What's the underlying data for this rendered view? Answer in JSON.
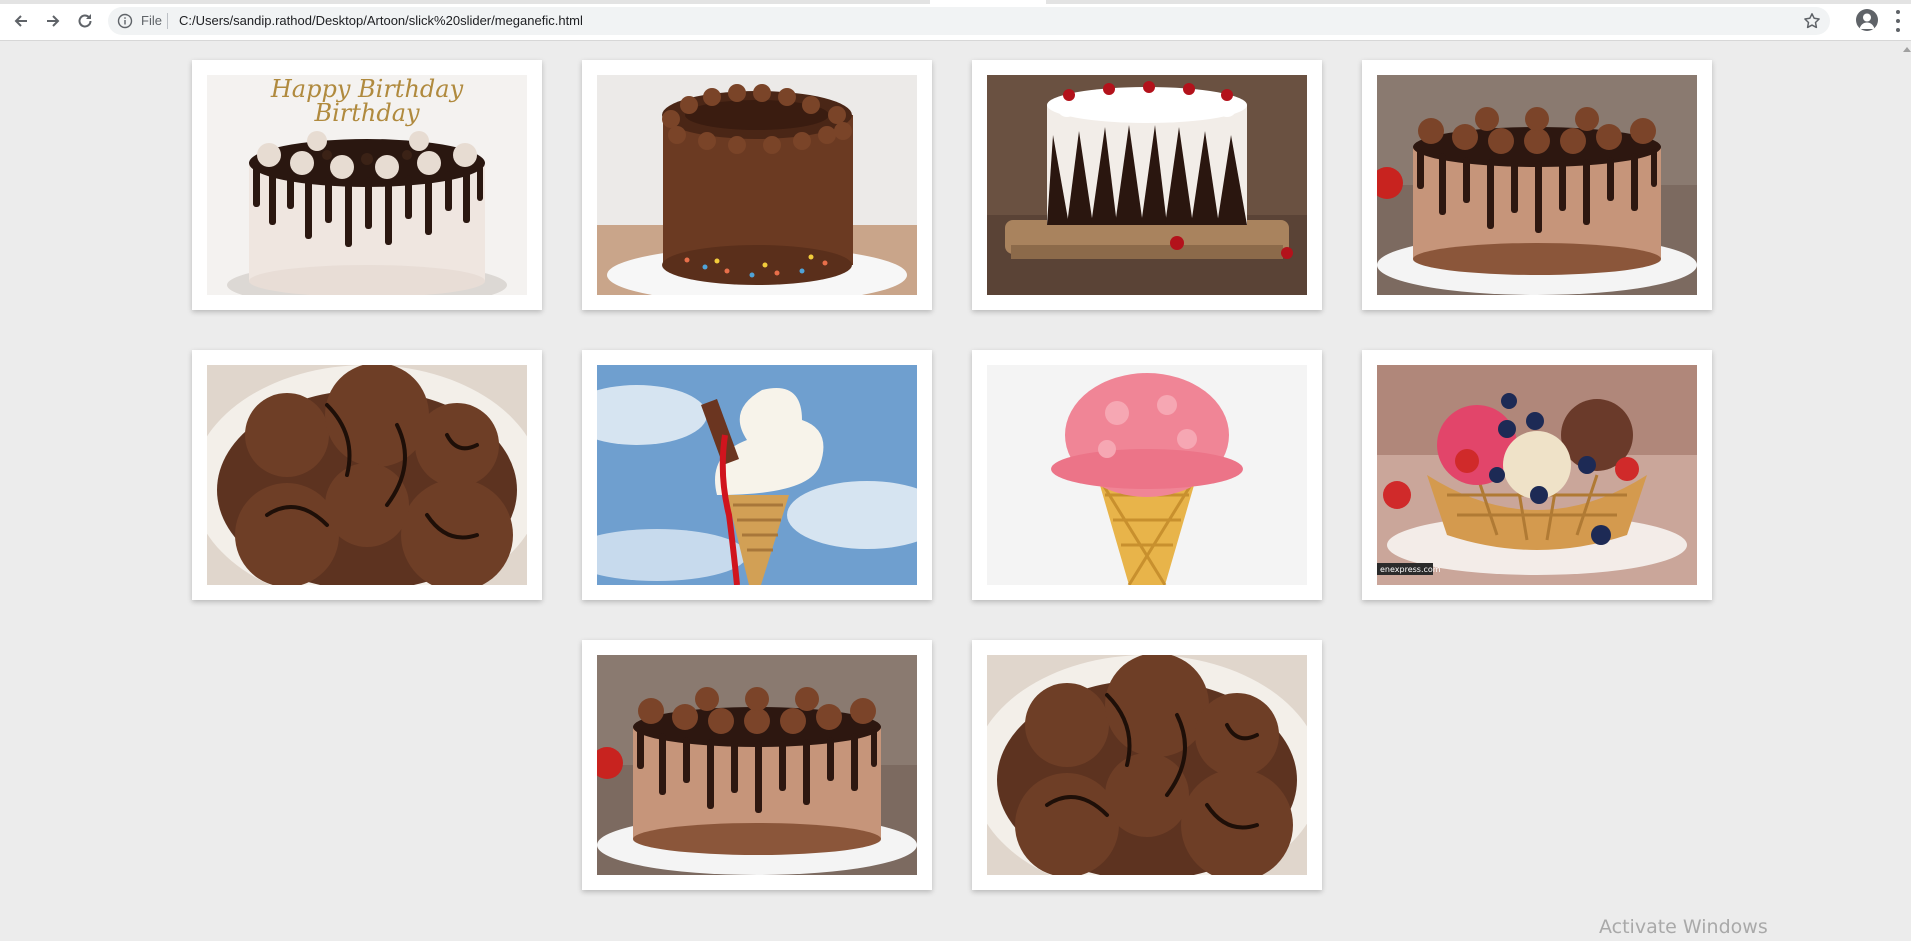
{
  "browser": {
    "file_label": "File",
    "url": "C:/Users/sandip.rathod/Desktop/Artoon/slick%20slider/meganefic.html",
    "icons": {
      "back": "arrow-left",
      "forward": "arrow-right",
      "reload": "reload",
      "info": "info-circle",
      "bookmark": "star-outline",
      "profile": "person",
      "menu": "three-dots-vertical"
    }
  },
  "gallery": {
    "items": [
      {
        "subject": "chocolate-drip-birthday-cake",
        "caption": "Happy Birthday",
        "watermark": ""
      },
      {
        "subject": "chocolate-frosted-sprinkle-cake",
        "caption": "",
        "watermark": ""
      },
      {
        "subject": "black-forest-cherry-cake",
        "caption": "",
        "watermark": ""
      },
      {
        "subject": "chocolate-drip-rosette-cake",
        "caption": "",
        "watermark": ""
      },
      {
        "subject": "chocolate-ice-cream-scoops",
        "caption": "",
        "watermark": ""
      },
      {
        "subject": "soft-serve-cone-with-flake",
        "caption": "",
        "watermark": ""
      },
      {
        "subject": "strawberry-ice-cream-cone",
        "caption": "",
        "watermark": ""
      },
      {
        "subject": "waffle-bowl-sundae-with-berries",
        "caption": "",
        "watermark": "enexpress.com"
      },
      {
        "subject": "chocolate-drip-rosette-cake",
        "caption": "",
        "watermark": ""
      },
      {
        "subject": "chocolate-ice-cream-scoops",
        "caption": "",
        "watermark": ""
      }
    ]
  },
  "os_watermark": "Activate Windows",
  "colors": {
    "page_bg": "#ececec",
    "card_bg": "#ffffff",
    "chocolate": "#6b3a22",
    "dark_chocolate": "#2e1a12"
  }
}
